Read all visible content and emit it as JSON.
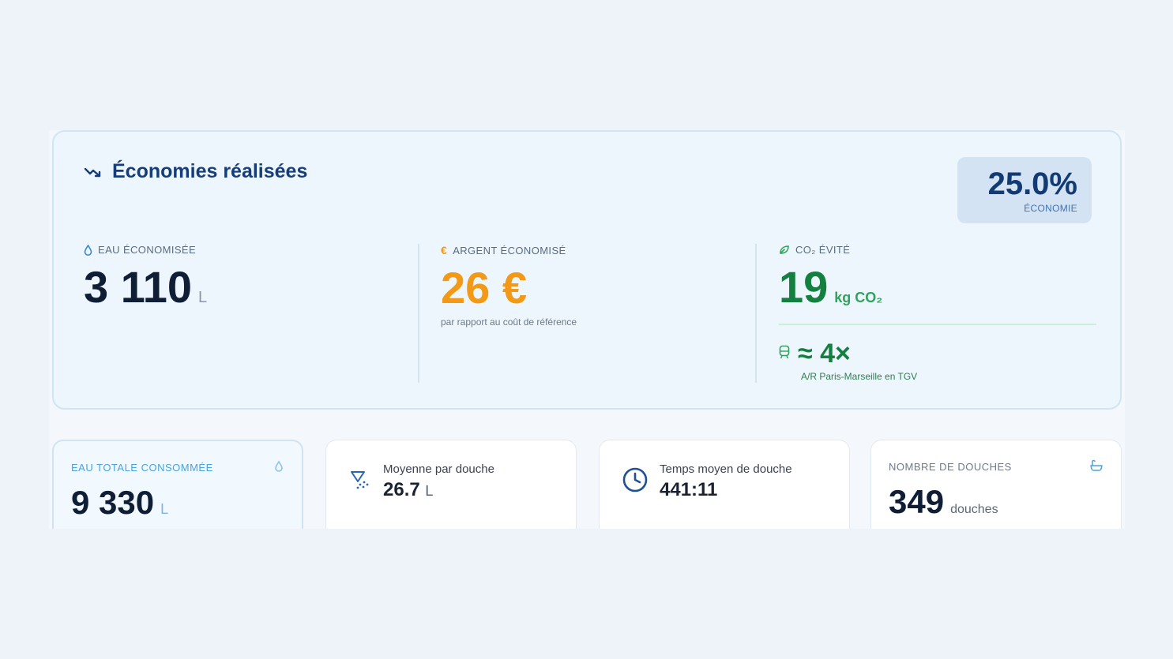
{
  "savings": {
    "title": "Économies réalisées",
    "badge": {
      "value": "25.0%",
      "label": "ÉCONOMIE"
    },
    "water": {
      "label": "EAU ÉCONOMISÉE",
      "value": "3 110",
      "unit": "L"
    },
    "money": {
      "label": "ARGENT ÉCONOMISÉ",
      "value": "26 €",
      "note": "par rapport au coût de référence"
    },
    "co2": {
      "label": "CO₂ ÉVITÉ",
      "value": "19",
      "unit": "kg CO₂",
      "equivalent": "≈ 4×",
      "equivalent_note": "A/R Paris-Marseille en TGV"
    }
  },
  "stats": {
    "total_water": {
      "label": "EAU TOTALE CONSOMMÉE",
      "value": "9 330",
      "unit": "L"
    },
    "avg_per_shower": {
      "label": "Moyenne par douche",
      "value": "26.7",
      "unit": "L"
    },
    "avg_time": {
      "label": "Temps moyen de douche",
      "value": "441:11"
    },
    "shower_count": {
      "label": "NOMBRE DE DOUCHES",
      "value": "349",
      "unit": "douches"
    }
  },
  "colors": {
    "primary": "#143d7a",
    "money": "#f29a17",
    "co2": "#13803f",
    "accent_blue": "#4aa3df"
  }
}
